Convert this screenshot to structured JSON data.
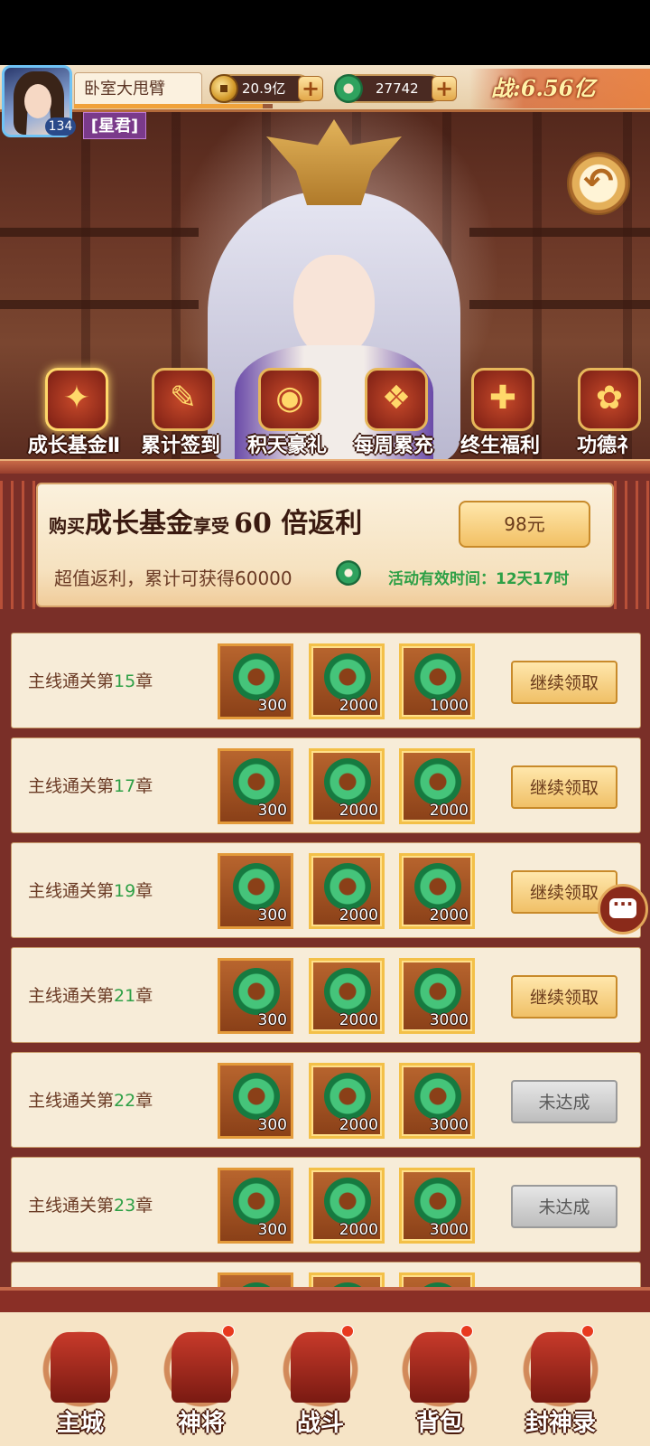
{
  "player": {
    "name": "卧室大甩臂",
    "level": "134",
    "title": "[星君]",
    "exp_fraction": 0.95
  },
  "resources": {
    "coins": "20.9亿",
    "jade": "27742",
    "plus": "+"
  },
  "power": "战:6.56亿",
  "back_icon": "↶",
  "tabs": [
    {
      "label": "成长基金Ⅱ",
      "icon": "growth-fund-icon",
      "glyph": "✦",
      "active": true
    },
    {
      "label": "累计签到",
      "icon": "sign-in-scroll-icon",
      "glyph": "✎",
      "active": false
    },
    {
      "label": "积天豪礼",
      "icon": "gold-coins-icon",
      "glyph": "◉",
      "active": false
    },
    {
      "label": "每周累充",
      "icon": "treasure-pouch-icon",
      "glyph": "❖",
      "active": false
    },
    {
      "label": "终生福利",
      "icon": "gift-box-icon",
      "glyph": "✚",
      "active": false
    },
    {
      "label": "功德礻",
      "icon": "merit-gift-icon",
      "glyph": "✿",
      "active": false
    }
  ],
  "banner": {
    "buy": "购买",
    "fund": "成长基金",
    "enjoy": "享受",
    "multiplier": "60 倍返利",
    "subtitle": "超值返利，累计可获得60000",
    "event_time": "活动有效时间：12天17时",
    "price": "98元"
  },
  "rows": [
    {
      "label_prefix": "主线通关第",
      "chapter": "15",
      "label_suffix": "章",
      "rewards": [
        "300",
        "2000",
        "1000"
      ],
      "action": "继续领取",
      "status": "claim"
    },
    {
      "label_prefix": "主线通关第",
      "chapter": "17",
      "label_suffix": "章",
      "rewards": [
        "300",
        "2000",
        "2000"
      ],
      "action": "继续领取",
      "status": "claim"
    },
    {
      "label_prefix": "主线通关第",
      "chapter": "19",
      "label_suffix": "章",
      "rewards": [
        "300",
        "2000",
        "2000"
      ],
      "action": "继续领取",
      "status": "claim"
    },
    {
      "label_prefix": "主线通关第",
      "chapter": "21",
      "label_suffix": "章",
      "rewards": [
        "300",
        "2000",
        "3000"
      ],
      "action": "继续领取",
      "status": "claim"
    },
    {
      "label_prefix": "主线通关第",
      "chapter": "22",
      "label_suffix": "章",
      "rewards": [
        "300",
        "2000",
        "3000"
      ],
      "action": "未达成",
      "status": "locked"
    },
    {
      "label_prefix": "主线通关第",
      "chapter": "23",
      "label_suffix": "章",
      "rewards": [
        "300",
        "2000",
        "3000"
      ],
      "action": "未达成",
      "status": "locked"
    },
    {
      "label_prefix": "",
      "chapter": "",
      "label_suffix": "",
      "rewards": [
        "",
        "",
        ""
      ],
      "action": "",
      "status": "locked"
    }
  ],
  "nav": [
    {
      "label": "主城",
      "icon": "main-city-icon",
      "badge": false
    },
    {
      "label": "神将",
      "icon": "hero-icon",
      "badge": true
    },
    {
      "label": "战斗",
      "icon": "battle-swords-icon",
      "badge": true
    },
    {
      "label": "背包",
      "icon": "backpack-icon",
      "badge": true
    },
    {
      "label": "封神录",
      "icon": "deification-record-icon",
      "badge": true
    }
  ],
  "colors": {
    "accent_gold": "#f0c067",
    "jade_green": "#2fa25e",
    "chapter_green": "#2ea046",
    "frame_red": "#7a2f28"
  }
}
